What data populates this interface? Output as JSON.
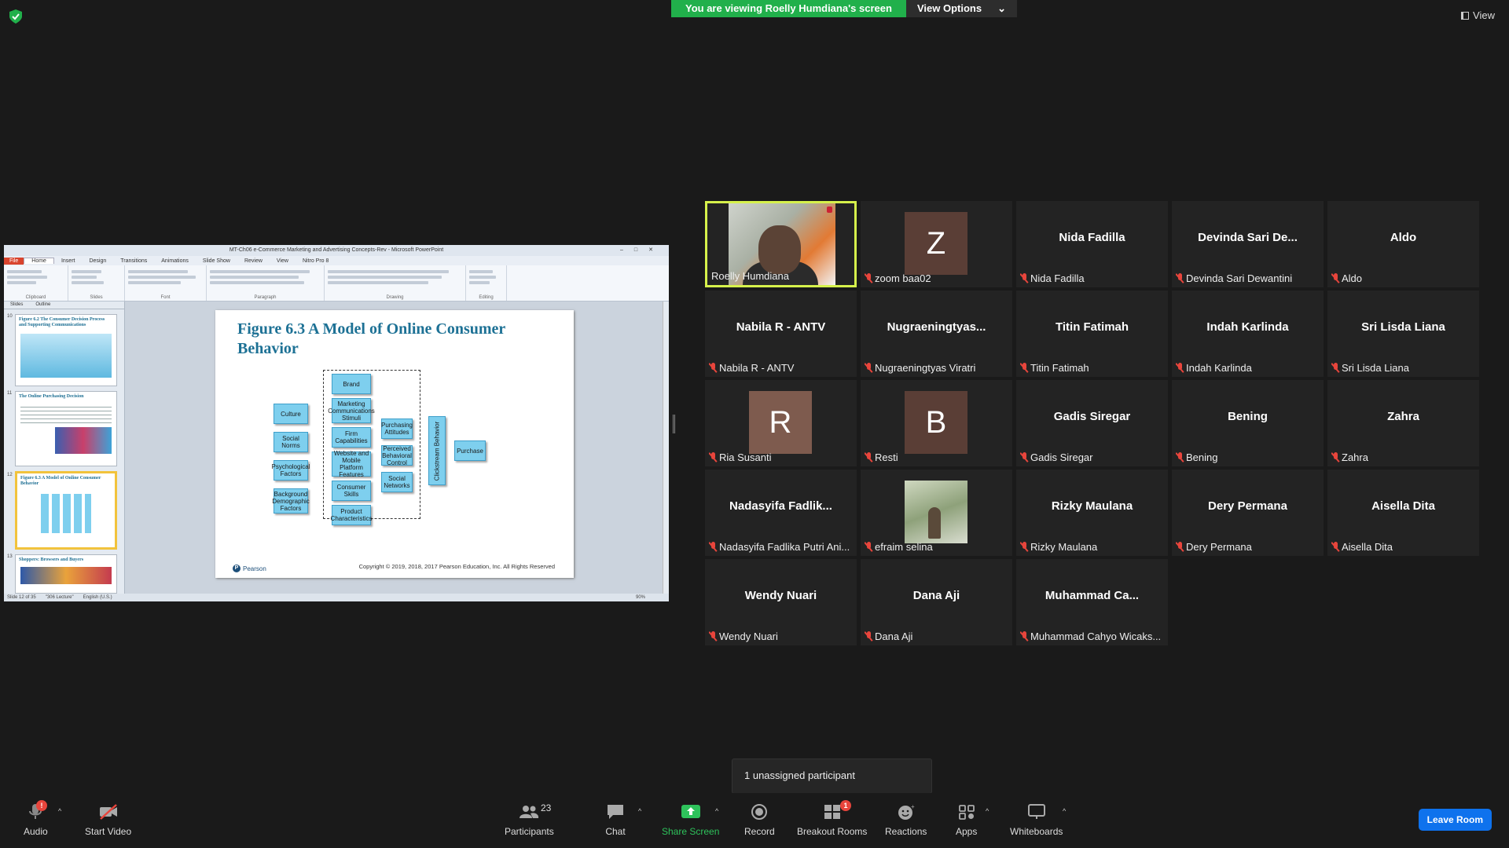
{
  "banner": {
    "viewing": "You are viewing Roelly Humdiana's screen",
    "view_options": "View Options"
  },
  "view_button": "View",
  "powerpoint": {
    "title": "MT-Ch06 e-Commerce Marketing and Advertising Concepts-Rev  -  Microsoft PowerPoint",
    "tabs": [
      "File",
      "Home",
      "Insert",
      "Design",
      "Transitions",
      "Animations",
      "Slide Show",
      "Review",
      "View",
      "Nitro Pro 8"
    ],
    "ribbon_groups": [
      "Clipboard",
      "Slides",
      "Font",
      "Paragraph",
      "Drawing",
      "Editing"
    ],
    "left_tabs": [
      "Slides",
      "Outline"
    ],
    "thumbnails": [
      {
        "num": "10",
        "title": "Figure 6.2 The Consumer Decision Process and Supporting Communications"
      },
      {
        "num": "11",
        "title": "The Online Purchasing Decision"
      },
      {
        "num": "12",
        "title": "Figure 6.3 A Model of Online Consumer Behavior"
      },
      {
        "num": "13",
        "title": "Shoppers: Browsers and Buyers"
      }
    ],
    "status": {
      "slide": "Slide 12 of 35",
      "theme": "\"306 Lecture\"",
      "lang": "English (U.S.)",
      "zoom": "90%"
    }
  },
  "slide": {
    "title": "Figure 6.3 A Model of Online Consumer Behavior",
    "left_boxes": [
      "Culture",
      "Social Norms",
      "Psychological Factors",
      "Background Demographic Factors"
    ],
    "center_boxes": [
      "Brand",
      "Marketing Communications Stimuli",
      "Firm Capabilities",
      "Website and Mobile Platform Features",
      "Consumer Skills",
      "Product Characteristics"
    ],
    "right_boxes": [
      "Purchasing Attitudes",
      "Perceived Behavioral Control",
      "Social Networks"
    ],
    "clickstream": "Clickstream Behavior",
    "purchase": "Purchase",
    "brand": "Pearson",
    "copyright": "Copyright © 2019, 2018, 2017 Pearson Education, Inc. All Rights Reserved"
  },
  "participants": [
    {
      "label": "Roelly Humdiana",
      "display": "",
      "type": "video",
      "muted": false,
      "active": true
    },
    {
      "label": "zoom baa02",
      "display": "Z",
      "type": "avatar",
      "color": "#5a3e36",
      "muted": true
    },
    {
      "label": "Nida Fadilla",
      "display": "Nida Fadilla",
      "type": "name",
      "muted": true
    },
    {
      "label": "Devinda Sari Dewantini",
      "display": "Devinda  Sari  De...",
      "type": "name",
      "muted": true
    },
    {
      "label": "Aldo",
      "display": "Aldo",
      "type": "name",
      "muted": true
    },
    {
      "label": "Nabila R - ANTV",
      "display": "Nabila R - ANTV",
      "type": "name",
      "muted": true
    },
    {
      "label": "Nugraeningtyas Viratri",
      "display": "Nugraeningtyas...",
      "type": "name",
      "muted": true
    },
    {
      "label": "Titin Fatimah",
      "display": "Titin Fatimah",
      "type": "name",
      "muted": true
    },
    {
      "label": "Indah Karlinda",
      "display": "Indah Karlinda",
      "type": "name",
      "muted": true
    },
    {
      "label": "Sri Lisda Liana",
      "display": "Sri Lisda Liana",
      "type": "name",
      "muted": true
    },
    {
      "label": "Ria Susanti",
      "display": "R",
      "type": "avatar",
      "color": "#7e5b4e",
      "muted": true
    },
    {
      "label": "Resti",
      "display": "B",
      "type": "avatar",
      "color": "#5a3e36",
      "muted": true
    },
    {
      "label": "Gadis Siregar",
      "display": "Gadis Siregar",
      "type": "name",
      "muted": true
    },
    {
      "label": "Bening",
      "display": "Bening",
      "type": "name",
      "muted": true
    },
    {
      "label": "Zahra",
      "display": "Zahra",
      "type": "name",
      "muted": true
    },
    {
      "label": "Nadasyifa Fadlika Putri Ani...",
      "display": "Nadasyifa  Fadlik...",
      "type": "name",
      "muted": true
    },
    {
      "label": "efraim selina",
      "display": "",
      "type": "photo",
      "muted": true
    },
    {
      "label": "Rizky Maulana",
      "display": "Rizky Maulana",
      "type": "name",
      "muted": true
    },
    {
      "label": "Dery Permana",
      "display": "Dery Permana",
      "type": "name",
      "muted": true
    },
    {
      "label": "Aisella Dita",
      "display": "Aisella Dita",
      "type": "name",
      "muted": true
    },
    {
      "label": "Wendy Nuari",
      "display": "Wendy Nuari",
      "type": "name",
      "muted": true
    },
    {
      "label": "Dana Aji",
      "display": "Dana Aji",
      "type": "name",
      "muted": true
    },
    {
      "label": "Muhammad Cahyo Wicaks...",
      "display": "Muhammad  Ca...",
      "type": "name",
      "muted": true
    }
  ],
  "popup": "1 unassigned participant",
  "toolbar": {
    "audio": "Audio",
    "audio_badge": "!",
    "video": "Start Video",
    "participants": "Participants",
    "participants_count": "23",
    "chat": "Chat",
    "share": "Share Screen",
    "record": "Record",
    "breakout": "Breakout Rooms",
    "breakout_badge": "1",
    "reactions": "Reactions",
    "apps": "Apps",
    "whiteboards": "Whiteboards",
    "leave": "Leave Room"
  },
  "colors": {
    "active_speaker": "#d6f14b",
    "share_green": "#21b04b",
    "leave_blue": "#0e72ed",
    "muted_red": "#e8453c"
  }
}
